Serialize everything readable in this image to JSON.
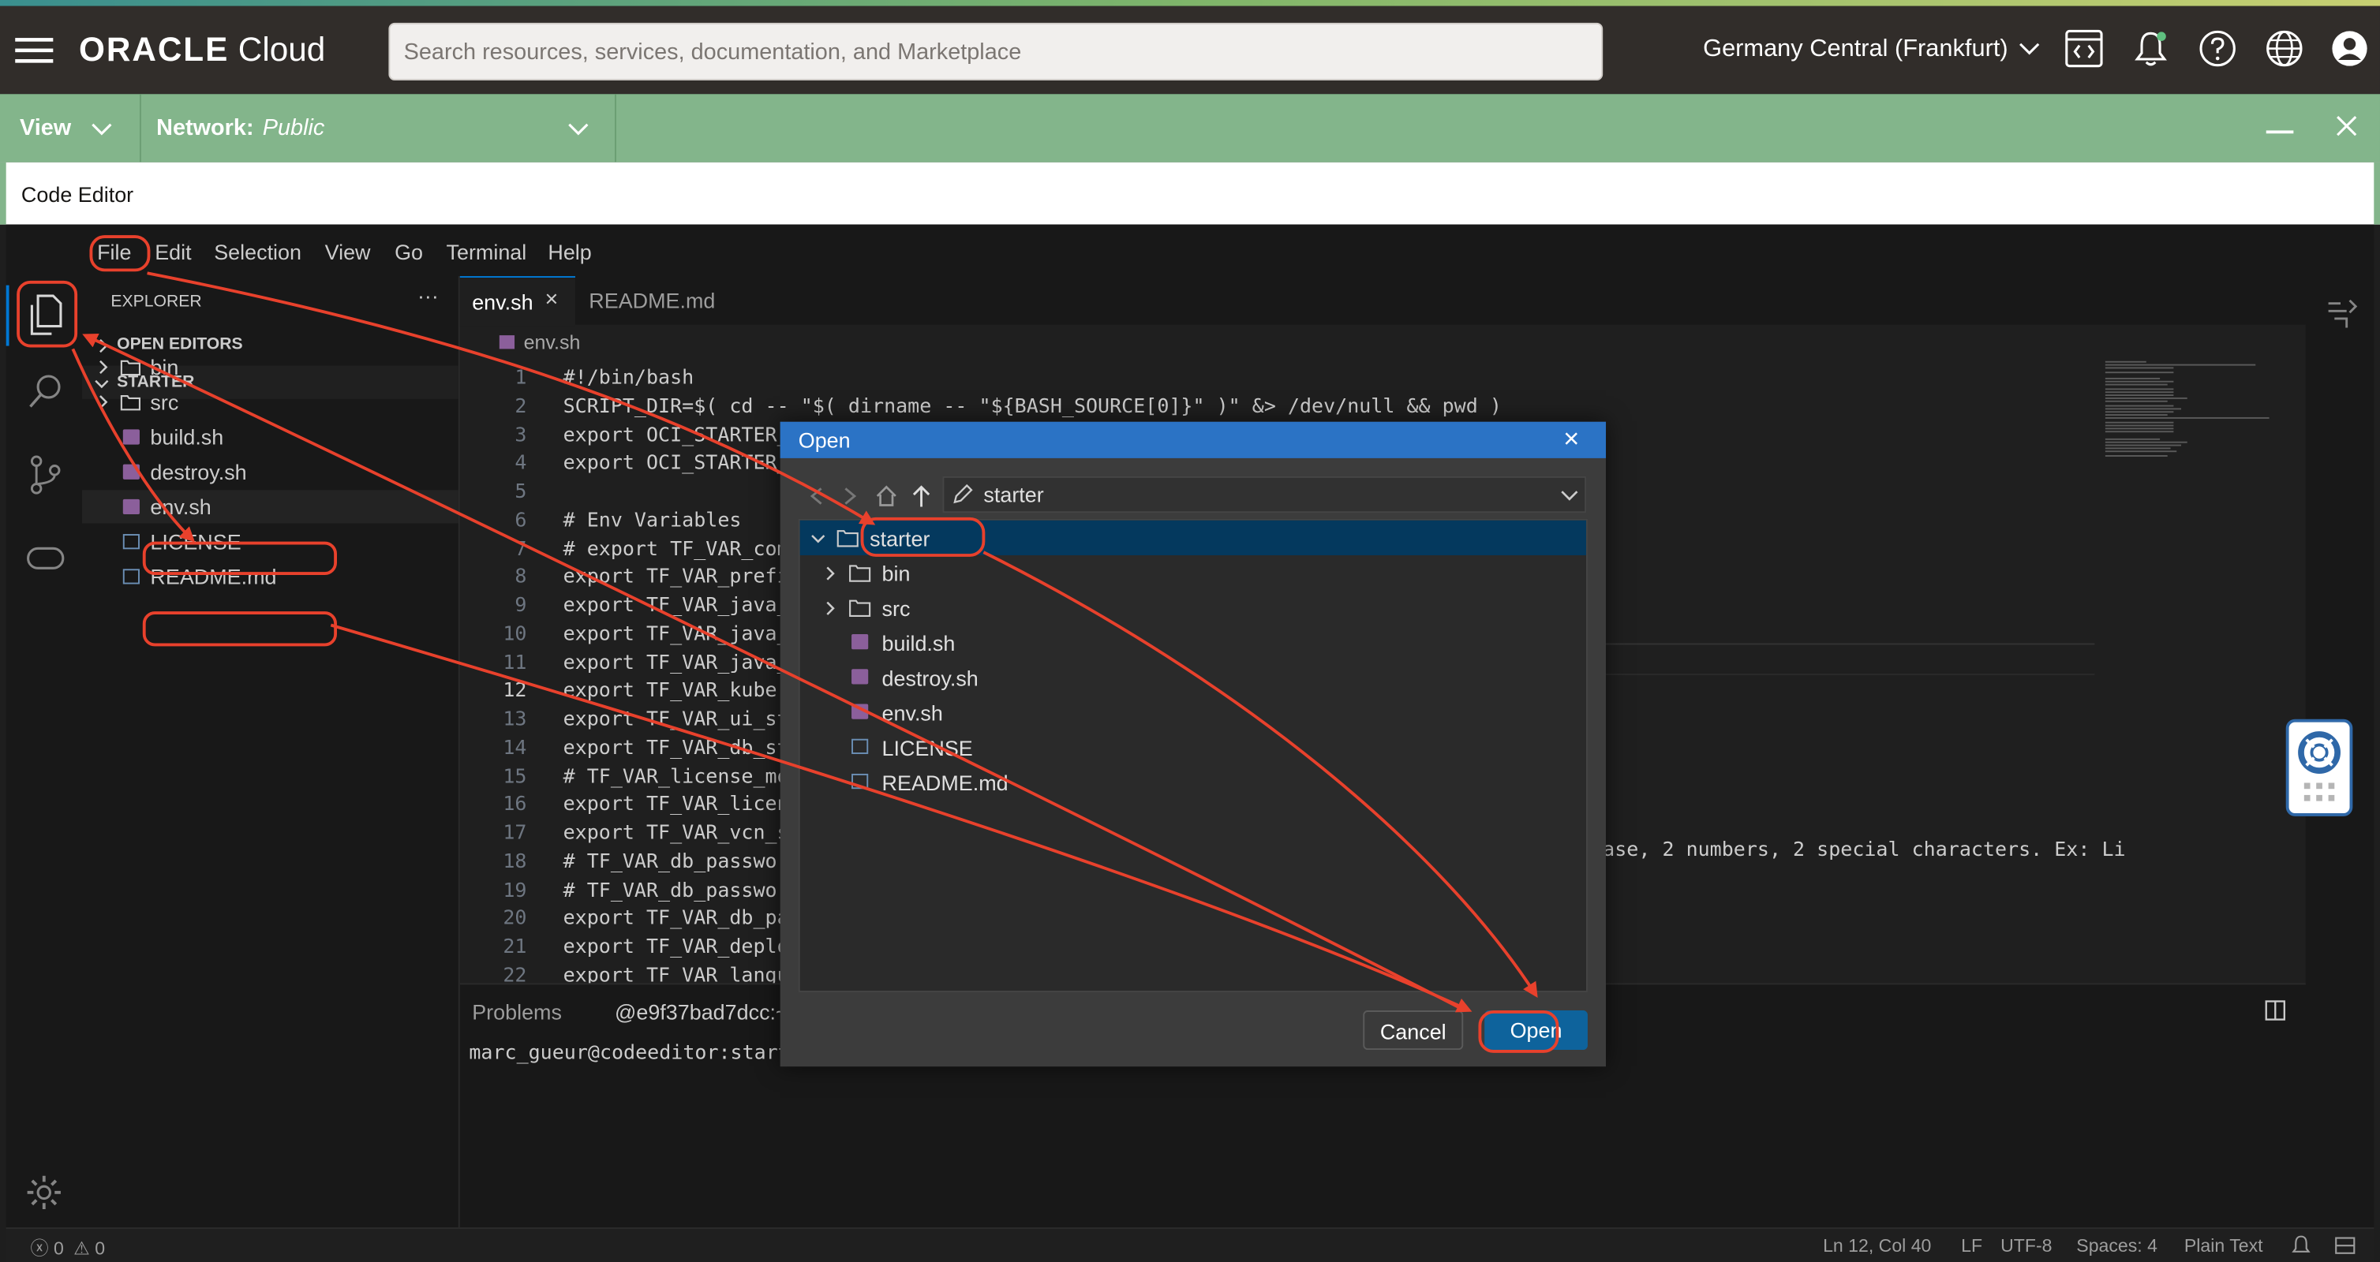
{
  "header": {
    "logo": "ORACLE Cloud",
    "logo_brand": "ORACLE",
    "logo_product": "Cloud",
    "search_placeholder": "Search resources, services, documentation, and Marketplace",
    "region": "Germany Central (Frankfurt)",
    "icons": [
      "hamburger-menu-icon",
      "code-editor-icon",
      "bell-icon",
      "help-icon",
      "globe-icon",
      "user-icon"
    ]
  },
  "shell_bar": {
    "view_label": "View",
    "network_label": "Network:",
    "network_value": "Public"
  },
  "code_editor_title": "Code Editor",
  "menubar": [
    "File",
    "Edit",
    "Selection",
    "View",
    "Go",
    "Terminal",
    "Help"
  ],
  "explorer": {
    "title": "EXPLORER",
    "more": "···",
    "open_editors": "OPEN EDITORS",
    "root": "STARTER",
    "items": [
      {
        "name": "bin",
        "type": "folder"
      },
      {
        "name": "src",
        "type": "folder"
      },
      {
        "name": "build.sh",
        "type": "shell"
      },
      {
        "name": "destroy.sh",
        "type": "shell"
      },
      {
        "name": "env.sh",
        "type": "shell"
      },
      {
        "name": "LICENSE",
        "type": "doc"
      },
      {
        "name": "README.md",
        "type": "doc"
      }
    ]
  },
  "tabs": [
    {
      "label": "env.sh",
      "close": "×",
      "active": true
    },
    {
      "label": "README.md",
      "active": false
    }
  ],
  "breadcrumb": "env.sh",
  "code_lines": [
    {
      "n": "1",
      "text": "#!/bin/bash"
    },
    {
      "n": "2",
      "text": "SCRIPT_DIR=$( cd -- \"$( dirname -- \"${BASH_SOURCE[0]}\" )\" &> /dev/null && pwd )"
    },
    {
      "n": "3",
      "text": "export OCI_STARTER_"
    },
    {
      "n": "4",
      "text": "export OCI_STARTER_"
    },
    {
      "n": "5",
      "text": ""
    },
    {
      "n": "6",
      "text": "# Env Variables"
    },
    {
      "n": "7",
      "text": "# export TF_VAR_com"
    },
    {
      "n": "8",
      "text": "export TF_VAR_prefi"
    },
    {
      "n": "9",
      "text": "export TF_VAR_java_"
    },
    {
      "n": "10",
      "text": "export TF_VAR_java_"
    },
    {
      "n": "11",
      "text": "export TF_VAR_java_"
    },
    {
      "n": "12",
      "text": "export TF_VAR_kuber"
    },
    {
      "n": "13",
      "text": "export TF_VAR_ui_st"
    },
    {
      "n": "14",
      "text": "export TF_VAR_db_st"
    },
    {
      "n": "15",
      "text": "# TF_VAR_license_mo"
    },
    {
      "n": "16",
      "text": "export TF_VAR_licen"
    },
    {
      "n": "17",
      "text": "export TF_VAR_vcn_s"
    },
    {
      "n": "18",
      "text": "# TF_VAR_db_passwor"
    },
    {
      "n": "19",
      "text": "# TF_VAR_db_passwor"
    },
    {
      "n": "20",
      "text": "export TF_VAR_db_pa"
    },
    {
      "n": "21",
      "text": "export TF_VAR_deplo"
    },
    {
      "n": "22",
      "text": "export TF_VAR_langu"
    }
  ],
  "code_line18_tail": "ase, 2 numbers, 2 special characters. Ex: Li",
  "panel": {
    "tab_problems": "Problems",
    "terminal_tab": "@e9f37bad7dcc:~",
    "prompt": "marc_gueur@codeeditor:start"
  },
  "statusbar": {
    "errors": "0",
    "warnings": "0",
    "position": "Ln 12, Col 40",
    "eol": "LF",
    "encoding": "UTF-8",
    "spaces": "Spaces: 4",
    "language": "Plain Text"
  },
  "dialog": {
    "title": "Open",
    "close": "×",
    "path": "starter",
    "items": [
      {
        "name": "starter",
        "type": "folder",
        "level": 0,
        "selected": true
      },
      {
        "name": "bin",
        "type": "folder",
        "level": 1
      },
      {
        "name": "src",
        "type": "folder",
        "level": 1
      },
      {
        "name": "build.sh",
        "type": "shell",
        "level": 1
      },
      {
        "name": "destroy.sh",
        "type": "shell",
        "level": 1
      },
      {
        "name": "env.sh",
        "type": "shell",
        "level": 1
      },
      {
        "name": "LICENSE",
        "type": "doc",
        "level": 1
      },
      {
        "name": "README.md",
        "type": "doc",
        "level": 1
      }
    ],
    "cancel_label": "Cancel",
    "open_label": "Open"
  },
  "colors": {
    "oracle_header": "#312d2a",
    "shell_green": "#83b58b",
    "dialog_title": "#2b73c5",
    "annotation_red": "#e8412c",
    "primary_button": "#0e639c"
  }
}
